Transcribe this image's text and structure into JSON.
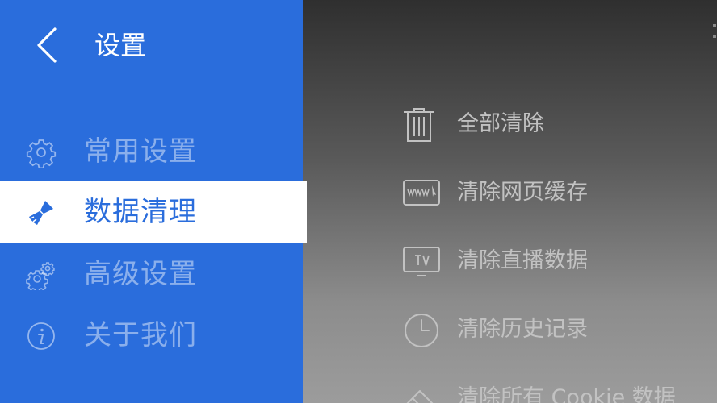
{
  "header": {
    "title": "设置",
    "back_icon": "chevron-left-icon"
  },
  "sidebar": {
    "items": [
      {
        "label": "常用设置",
        "icon": "gear-icon",
        "active": false
      },
      {
        "label": "数据清理",
        "icon": "broom-icon",
        "active": true
      },
      {
        "label": "高级设置",
        "icon": "gears-icon",
        "active": false
      },
      {
        "label": "关于我们",
        "icon": "info-icon",
        "active": false
      }
    ]
  },
  "options": {
    "items": [
      {
        "label": "全部清除",
        "icon": "trash-icon"
      },
      {
        "label": "清除网页缓存",
        "icon": "www-icon"
      },
      {
        "label": "清除直播数据",
        "icon": "tv-icon"
      },
      {
        "label": "清除历史记录",
        "icon": "clock-icon"
      },
      {
        "label": "清除所有 Cookie 数据",
        "icon": "eraser-icon"
      }
    ]
  },
  "colors": {
    "sidebar_bg": "#2a6ddc",
    "active_bg": "#ffffff",
    "active_text": "#2a6ddc",
    "option_text": "#c2c2c2"
  }
}
